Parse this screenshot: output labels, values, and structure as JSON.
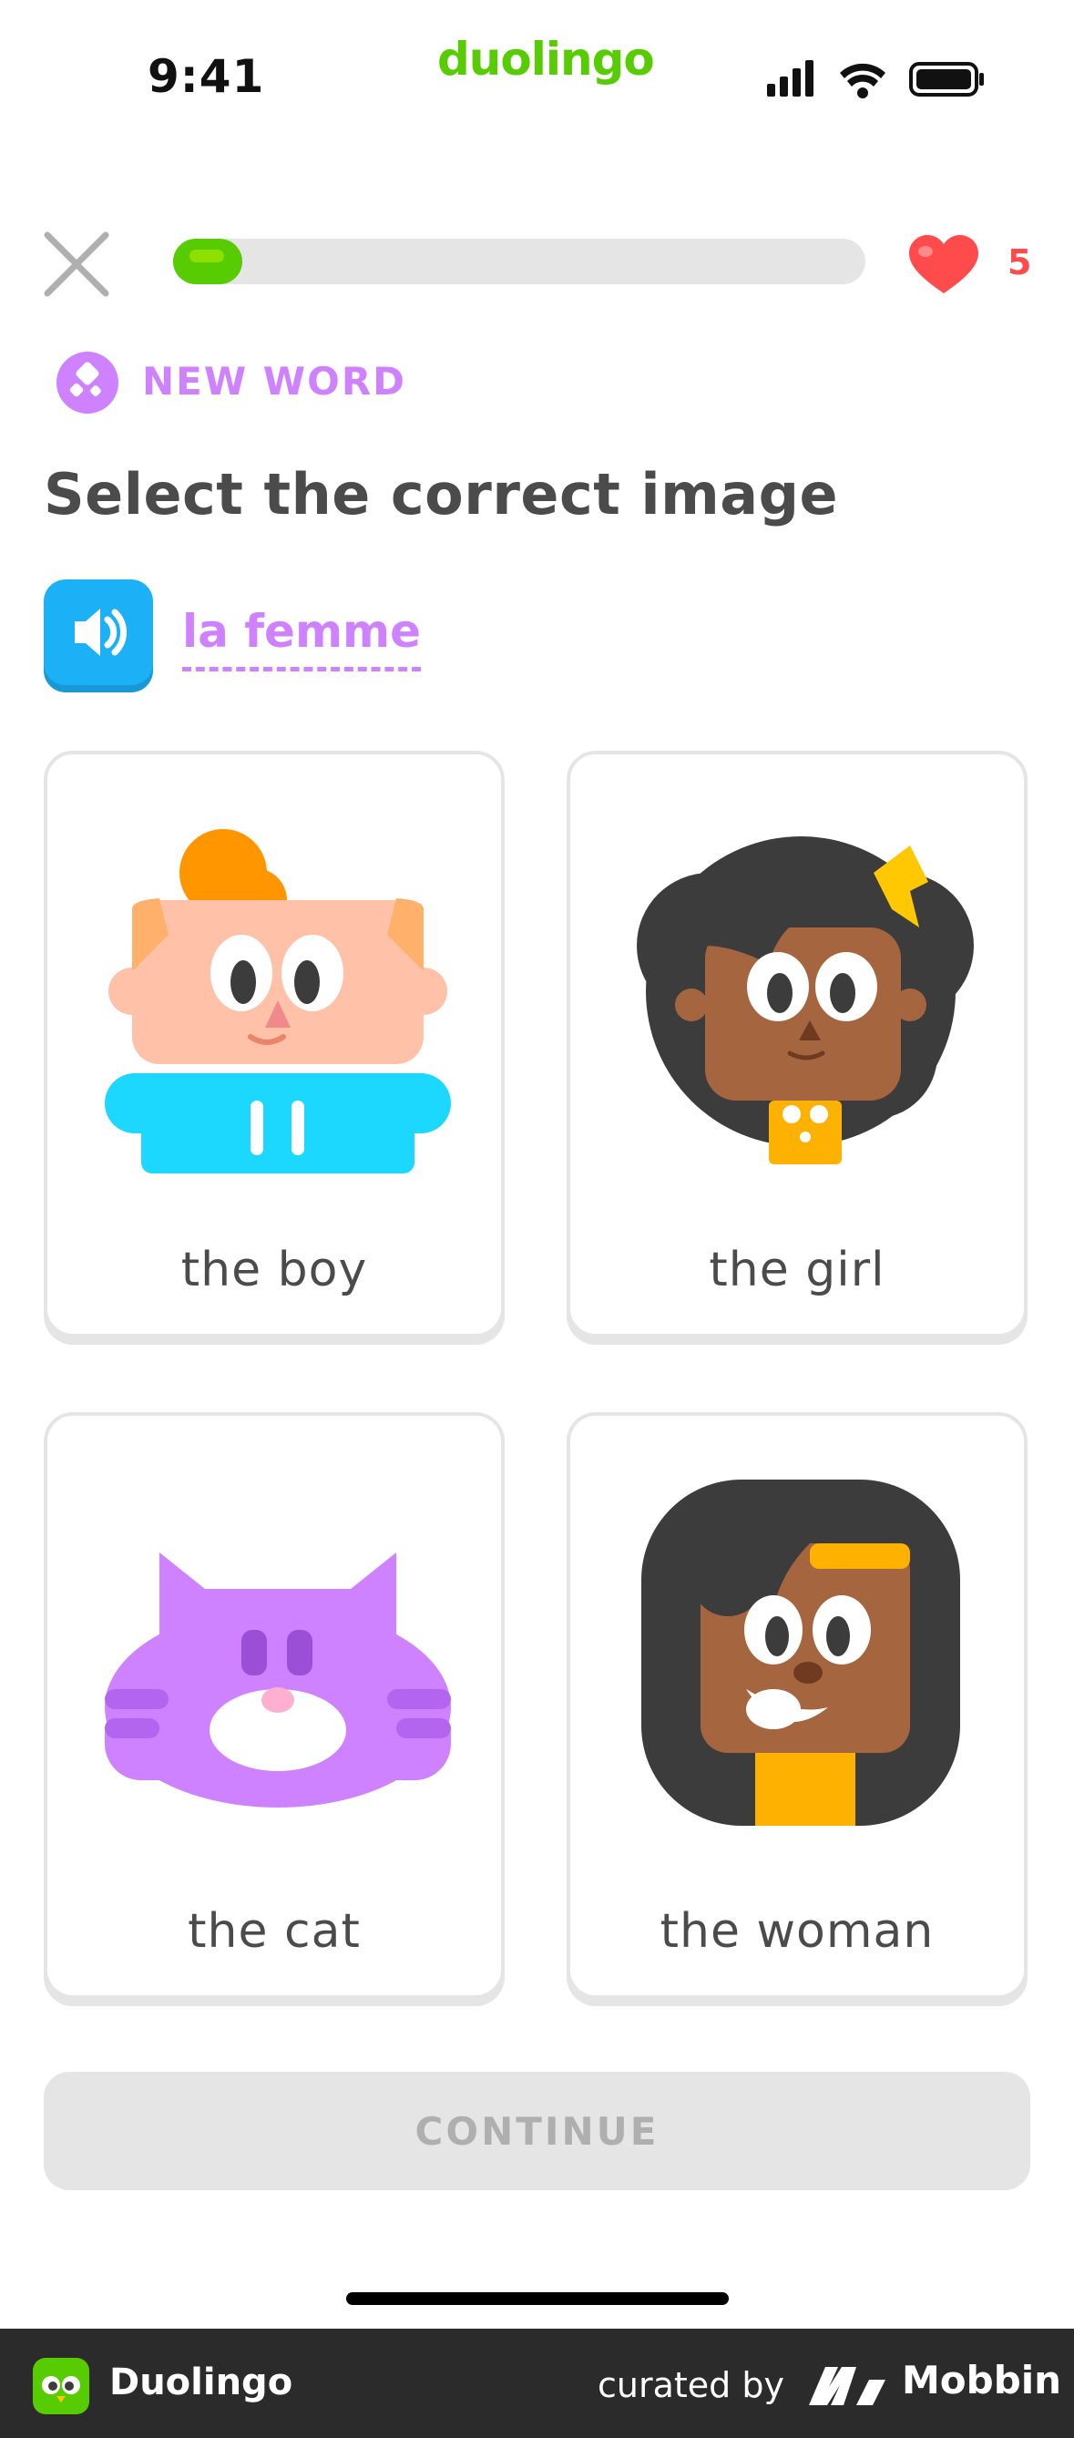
{
  "status_bar": {
    "time": "9:41",
    "brand": "duolingo"
  },
  "header": {
    "progress_fraction": 0.1,
    "hearts": "5"
  },
  "new_word": {
    "label": "NEW WORD"
  },
  "prompt": {
    "title": "Select the correct image",
    "word": "la femme"
  },
  "options": [
    {
      "label": "the boy",
      "icon": "boy-avatar"
    },
    {
      "label": "the girl",
      "icon": "girl-avatar"
    },
    {
      "label": "the cat",
      "icon": "cat-avatar"
    },
    {
      "label": "the woman",
      "icon": "woman-avatar"
    }
  ],
  "continue_label": "CONTINUE",
  "footer": {
    "app_name": "Duolingo",
    "curated_by": "curated by",
    "brand": "Mobbin"
  },
  "colors": {
    "accent_green": "#58cc02",
    "purple": "#ce82ff",
    "blue": "#1cb0f6",
    "red": "#ff4b4b",
    "disabled": "#e5e5e5"
  }
}
